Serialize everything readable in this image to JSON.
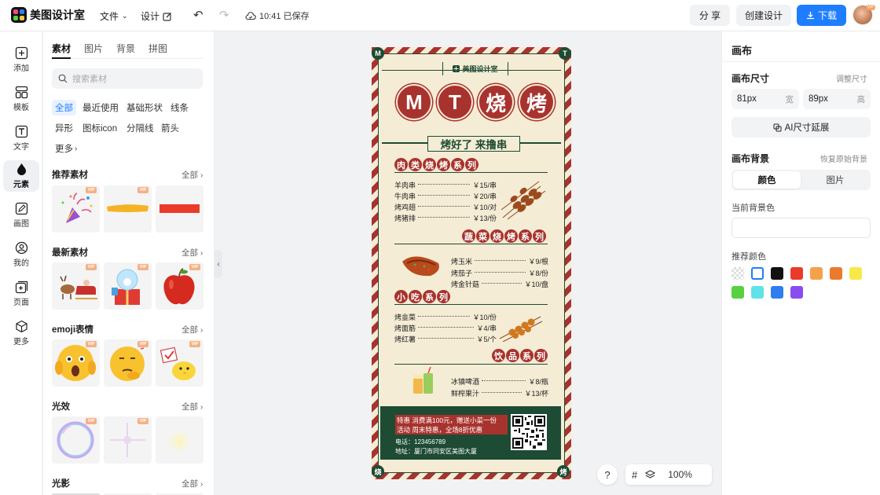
{
  "app": {
    "name": "美图设计室"
  },
  "topbar": {
    "file_label": "文件",
    "design_label": "设计",
    "saved_text": "10:41 已保存",
    "share_label": "分 享",
    "create_label": "创建设计",
    "download_label": "下载",
    "avatar_badge": "VIP"
  },
  "rail": [
    {
      "label": "添加",
      "icon": "plus-square-icon"
    },
    {
      "label": "模板",
      "icon": "template-icon"
    },
    {
      "label": "文字",
      "icon": "text-icon"
    },
    {
      "label": "元素",
      "icon": "shapes-icon"
    },
    {
      "label": "画图",
      "icon": "pencil-icon"
    },
    {
      "label": "我的",
      "icon": "user-icon"
    },
    {
      "label": "页面",
      "icon": "page-add-icon"
    },
    {
      "label": "更多",
      "icon": "cube-icon"
    }
  ],
  "panel": {
    "tabs": [
      "素材",
      "图片",
      "背景",
      "拼图"
    ],
    "search_placeholder": "搜索素材",
    "chips": [
      "全部",
      "最近使用",
      "基础形状",
      "线条",
      "异形",
      "图标icon",
      "分隔线",
      "箭头",
      "更多"
    ],
    "vip": "VIP",
    "sections": [
      {
        "title": "推荐素材",
        "all": "全部"
      },
      {
        "title": "最新素材",
        "all": "全部"
      },
      {
        "title": "emoji表情",
        "all": "全部"
      },
      {
        "title": "光效",
        "all": "全部"
      },
      {
        "title": "光影",
        "all": "全部"
      }
    ]
  },
  "poster": {
    "corner_tl": "M",
    "corner_tr": "T",
    "corner_bl": "烧",
    "corner_br": "烤",
    "brand": "美图设计室",
    "title_chars": [
      "M",
      "T",
      "烧",
      "烤"
    ],
    "slogan": "烤好了 来撸串",
    "cat1": [
      "肉",
      "类",
      "烧",
      "烤",
      "系",
      "列"
    ],
    "cat2": [
      "蔬",
      "菜",
      "烧",
      "烤",
      "系",
      "列"
    ],
    "cat3": [
      "小",
      "吃",
      "系",
      "列"
    ],
    "cat4": [
      "饮",
      "品",
      "系",
      "列"
    ],
    "menu1": [
      {
        "name": "羊肉串",
        "price": "￥15/串"
      },
      {
        "name": "牛肉串",
        "price": "￥20/串"
      },
      {
        "name": "烤鸡翅",
        "price": "￥10/对"
      },
      {
        "name": "烤猪排",
        "price": "￥13/份"
      }
    ],
    "menu2": [
      {
        "name": "烤玉米",
        "price": "￥9/根"
      },
      {
        "name": "烤茄子",
        "price": "￥8/份"
      },
      {
        "name": "烤金针菇",
        "price": "￥10/盘"
      }
    ],
    "menu3": [
      {
        "name": "烤韭菜",
        "price": "￥10/份"
      },
      {
        "name": "烤面筋",
        "price": "￥4/串"
      },
      {
        "name": "烤红薯",
        "price": "￥5/个"
      }
    ],
    "menu4": [
      {
        "name": "冰镇啤酒",
        "price": "￥8/瓶"
      },
      {
        "name": "鲜榨果汁",
        "price": "￥13/杯"
      }
    ],
    "promo_line1": "特惠  消费满100元，赠送小菜一份",
    "promo_line2": "活动  周末特惠，全场8折优惠",
    "phone": "电话：123456789",
    "address": "地址：厦门市同安区美图大厦"
  },
  "canvas_tools": {
    "help": "?",
    "zoom": "100%"
  },
  "right": {
    "title": "画布",
    "size_label": "画布尺寸",
    "adjust_size": "调整尺寸",
    "width_value": "81px",
    "width_unit": "宽",
    "height_value": "89px",
    "height_unit": "高",
    "ai_button": "AI尺寸延展",
    "bg_label": "画布背景",
    "restore_bg": "恢复原始背景",
    "seg_color": "颜色",
    "seg_image": "图片",
    "current_bg": "当前背景色",
    "recommend": "推荐颜色",
    "colors": [
      "transparent",
      "#ffffff",
      "#111111",
      "#ea3b2a",
      "#f4a24a",
      "#ec7a2c",
      "#f8e84a",
      "#57d13f",
      "#5de3e8",
      "#2f7ef0",
      "#8a4cf0"
    ],
    "accent": "#1f7dff"
  }
}
